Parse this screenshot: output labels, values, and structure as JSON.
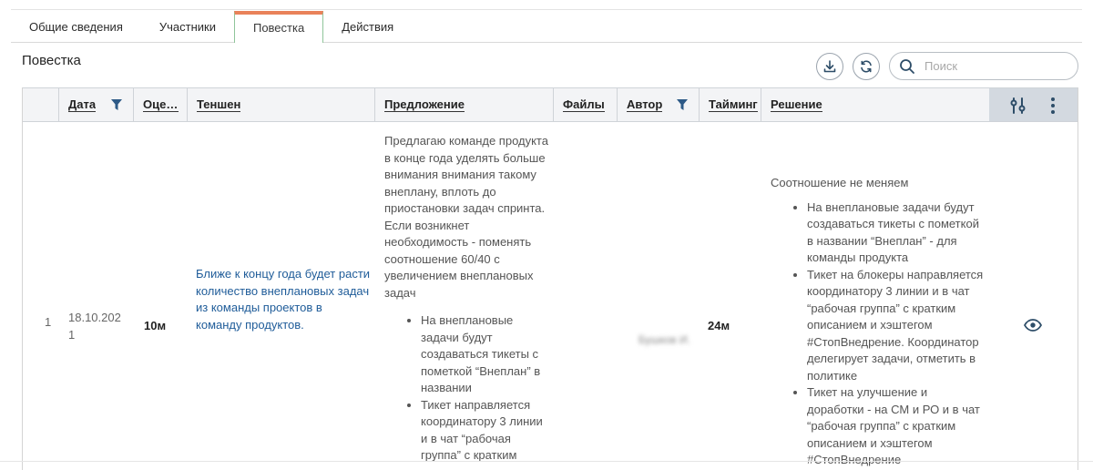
{
  "tabs": [
    {
      "label": "Общие сведения",
      "active": false
    },
    {
      "label": "Участники",
      "active": false
    },
    {
      "label": "Повестка",
      "active": true
    },
    {
      "label": "Действия",
      "active": false
    }
  ],
  "section": {
    "title": "Повестка"
  },
  "toolbar": {
    "download_icon": "download-icon",
    "refresh_icon": "refresh-icon",
    "search_icon": "search-icon",
    "search_placeholder": "Поиск",
    "search_value": ""
  },
  "table": {
    "columns": [
      {
        "key": "date",
        "label": "Дата",
        "filter": true
      },
      {
        "key": "estimate",
        "label": "Оценка"
      },
      {
        "key": "tension",
        "label": "Теншен"
      },
      {
        "key": "proposal",
        "label": "Предложение"
      },
      {
        "key": "files",
        "label": "Файлы"
      },
      {
        "key": "author",
        "label": "Автор",
        "filter": true
      },
      {
        "key": "timing",
        "label": "Тайминг"
      },
      {
        "key": "decision",
        "label": "Решение"
      }
    ],
    "header_tools": {
      "settings_icon": "column-settings-icon",
      "menu_icon": "more-vertical-icon"
    },
    "rows": [
      {
        "index": "1",
        "date": "18.10.2021",
        "estimate": "10м",
        "tension": "Ближе к концу года будет расти количество внеплановых задач из команды проектов в команду продуктов.",
        "proposal_paragraph": "Предлагаю команде продукта в конце года уделять больше внимания внимания такому внеплану, вплоть до приостановки задач спринта. Если возникнет необходимость - поменять соотношение 60/40 с увеличением внеплановых задач",
        "proposal_bullets": [
          "На внеплановые задачи будут создаваться тикеты с пометкой “Внеплан” в названии",
          "Тикет направляется координатору 3 линии и в чат “рабочая группа” с кратким"
        ],
        "files": "",
        "author": "Бушков И.",
        "timing": "24м",
        "decision_paragraph": "Соотношение не меняем",
        "decision_bullets": [
          "На внеплановые задачи будут создаваться тикеты с пометкой в названии “Внеплан” - для команды продукта",
          "Тикет на блокеры направляется координатору 3 линии и в чат “рабочая группа” с кратким описанием и хэштегом #СтопВнедрение. Координатор делегирует задачи, отметить в политике",
          "Тикет на улучшение и доработки - на СМ и РО и в чат “рабочая группа” с кратким описанием и хэштегом #СтопВнедрение"
        ],
        "view_icon": "eye-icon"
      }
    ]
  },
  "colors": {
    "accent": "#2d4d68",
    "link": "#1f5c99",
    "tab_active_top": "#e9825a",
    "tab_active_border": "#8fc59a"
  }
}
